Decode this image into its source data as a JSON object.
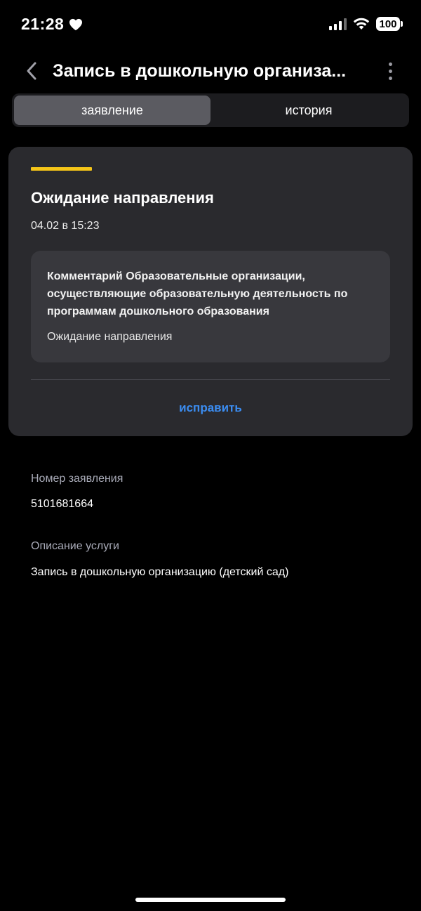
{
  "status_bar": {
    "time": "21:28",
    "battery": "100",
    "icons": [
      "heart-icon",
      "signal-icon",
      "wifi-icon",
      "battery-icon"
    ]
  },
  "header": {
    "title": "Запись в дошкольную организа...",
    "back_icon": "chevron-left-icon",
    "more_icon": "more-vertical-icon"
  },
  "tabs": [
    {
      "label": "заявление",
      "active": true
    },
    {
      "label": "история",
      "active": false
    }
  ],
  "status_card": {
    "accent_color": "#f5c518",
    "status": "Ожидание направления",
    "date": "04.02 в 15:23",
    "comment": {
      "title": "Комментарий Образовательные организации, осуществляющие образовательную деятельность по программам дошкольного образования",
      "text": "Ожидание направления"
    },
    "action_label": "исправить",
    "action_color": "#3b8df2"
  },
  "details": [
    {
      "label": "Номер заявления",
      "value": "5101681664"
    },
    {
      "label": "Описание услуги",
      "value": "Запись в дошкольную организацию (детский сад)"
    }
  ]
}
